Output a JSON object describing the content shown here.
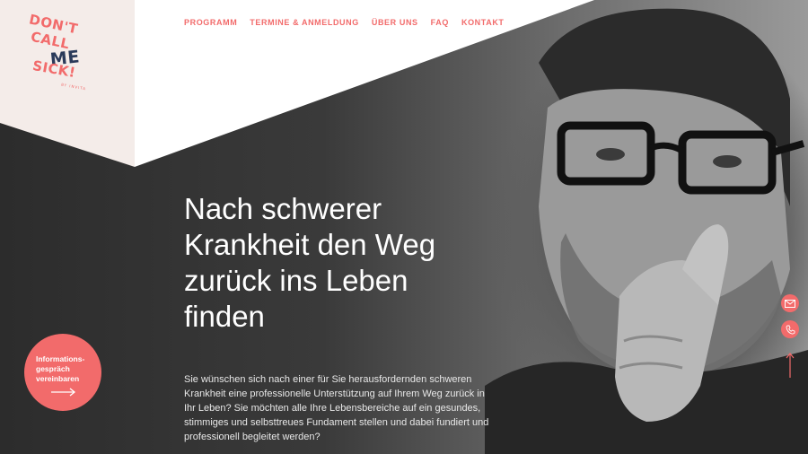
{
  "logo": {
    "lines": [
      "DON'T",
      "CALL",
      "ME",
      "SICK!"
    ],
    "sub": "BY INVITA"
  },
  "nav": {
    "items": [
      "PROGRAMM",
      "TERMINE & ANMELDUNG",
      "ÜBER UNS",
      "FAQ",
      "KONTAKT"
    ]
  },
  "hero": {
    "headline_lines": [
      "Nach schwerer",
      "Krankheit den Weg",
      "zurück ins Leben",
      "finden"
    ],
    "intro": "Sie wünschen sich nach einer für Sie herausfordernden schweren Krankheit eine professionelle Unterstützung auf Ihrem Weg zurück in Ihr Leben? Sie möchten alle Ihre Lebensbereiche auf ein gesundes, stimmiges und selbsttreues Fundament stellen und dabei fundiert und professionell begleitet werden?"
  },
  "cta": {
    "lines": [
      "Informations-",
      "gespräch",
      "vereinbaren"
    ],
    "icon": "arrow-right-icon"
  },
  "side_buttons": {
    "mail_icon": "mail-icon",
    "phone_icon": "phone-icon",
    "top_icon": "arrow-up-icon"
  },
  "colors": {
    "accent": "#f26b6b",
    "logo_dark": "#2a3a5a",
    "panel": "#f4ece9",
    "hero_dark": "#2a2a2a"
  }
}
